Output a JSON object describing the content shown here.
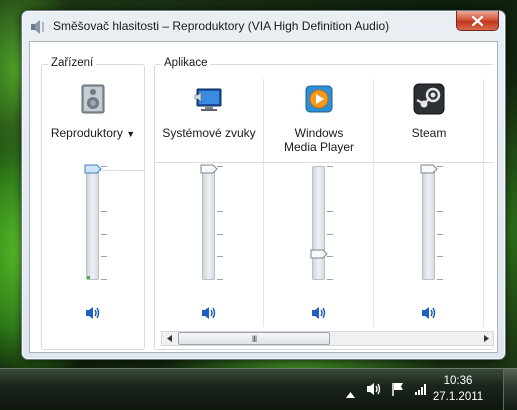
{
  "window": {
    "title": "Směšovač hlasitosti – Reproduktory (VIA High Definition Audio)",
    "close_icon": "close-icon"
  },
  "device": {
    "group_label": "Zařízení",
    "label": "Reproduktory",
    "dropdown_icon": "chevron-down-icon",
    "volume": 1.0,
    "muted": false
  },
  "apps": {
    "group_label": "Aplikace",
    "items": [
      {
        "label": "Systémové zvuky",
        "icon": "system-sounds-icon",
        "volume": 1.0
      },
      {
        "label": "Windows Media Player",
        "icon": "media-player-icon",
        "volume": 0.2
      },
      {
        "label": "Steam",
        "icon": "steam-icon",
        "volume": 1.0
      }
    ],
    "scroll_thumb_label": "III"
  },
  "taskbar": {
    "time": "10:36",
    "date": "27.1.2011"
  },
  "colors": {
    "accent": "#1f5fbf",
    "close_button": "#c1361c",
    "desktop": "#2f7d19"
  }
}
